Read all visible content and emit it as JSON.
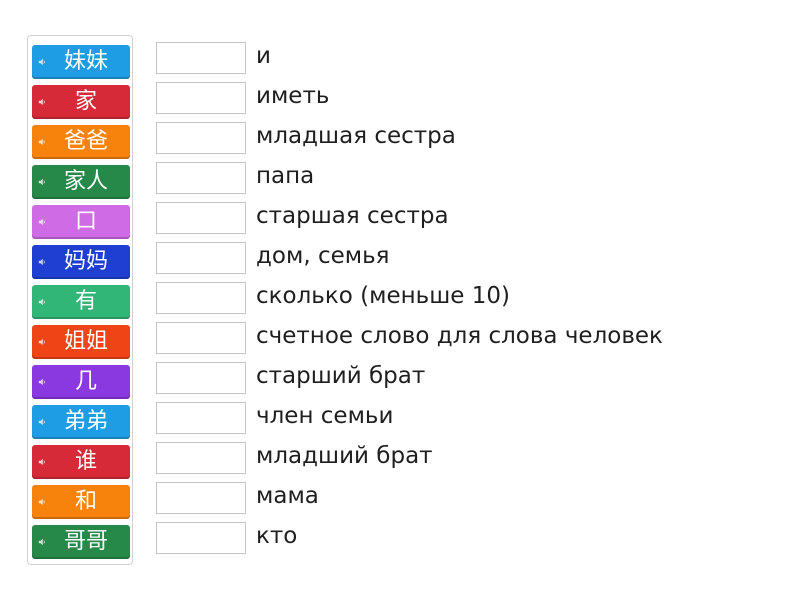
{
  "tiles": [
    {
      "word": "妹妹",
      "color": "#1e9de4"
    },
    {
      "word": "家",
      "color": "#d72a38"
    },
    {
      "word": "爸爸",
      "color": "#f7830c"
    },
    {
      "word": "家人",
      "color": "#26894a"
    },
    {
      "word": "口",
      "color": "#d06be6"
    },
    {
      "word": "妈妈",
      "color": "#1f3fd3"
    },
    {
      "word": "有",
      "color": "#32b678"
    },
    {
      "word": "姐姐",
      "color": "#ee4416"
    },
    {
      "word": "几",
      "color": "#8a38e0"
    },
    {
      "word": "弟弟",
      "color": "#1e9de4"
    },
    {
      "word": "谁",
      "color": "#d72a38"
    },
    {
      "word": "和",
      "color": "#f7830c"
    },
    {
      "word": "哥哥",
      "color": "#26894a"
    }
  ],
  "definitions": [
    "и",
    "иметь",
    "младшая сестра",
    "папа",
    "старшая сестра",
    "дом, семья",
    "сколько (меньше 10)",
    "счетное слово для слова человек",
    "старший брат",
    "член семьи",
    "младший брат",
    "мама",
    "кто"
  ],
  "icons": {
    "tile_audio": "speaker-icon"
  }
}
